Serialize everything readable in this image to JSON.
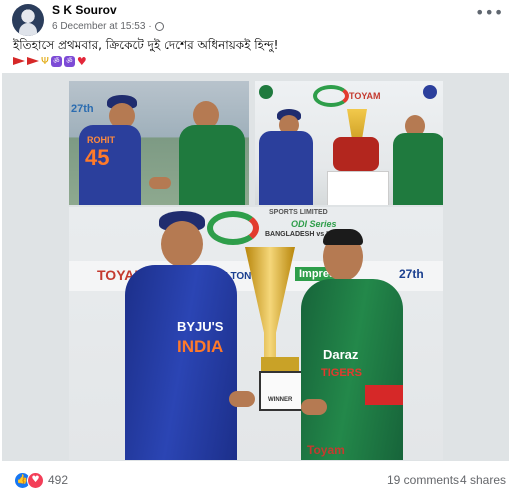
{
  "post": {
    "author": "S K Sourov",
    "timestamp": "6 December at 15:53",
    "privacy_icon": "globe-icon",
    "more_icon": "more-options-icon",
    "text": "ইতিহাসে প্রথমবার, ক্রিকেটে দুই দেশের অধিনায়কই হিন্দু!",
    "emoji_icons": [
      "flag-icon",
      "flag-icon",
      "trident-icon",
      "om-icon",
      "om-icon",
      "heart-icon"
    ]
  },
  "image": {
    "panel1": {
      "jersey_name": "ROHIT",
      "jersey_number": "45",
      "banner_number": "27th"
    },
    "panel2": {
      "sponsor": "TOYAM"
    },
    "panel3": {
      "banner_top": "SPORTS LIMITED",
      "banner_series": "ODI Series",
      "banner_teams": "BANGLADESH vs INDIA",
      "sponsor_left": "TOYAM",
      "sponsor_walton": "WALTON",
      "sponsor_imprese": "Impress",
      "banner_27th": "27th",
      "sponsor_bottom": "Toyam",
      "india_sponsor": "BYJU'S",
      "india_text": "INDIA",
      "bd_sponsor": "Daraz",
      "bd_text": "TIGERS",
      "trophy_plate": "WINNER"
    }
  },
  "footer": {
    "reaction_count": "492",
    "comments": "19 comments",
    "shares": "4 shares",
    "like_icon": "like-reaction-icon",
    "love_icon": "love-reaction-icon"
  },
  "colors": {
    "text_primary": "#050505",
    "text_secondary": "#65676b",
    "like_blue": "#1877f2",
    "love_red": "#f33e58",
    "india_blue": "#2b3f9c",
    "bangladesh_green": "#1f7a3e"
  }
}
